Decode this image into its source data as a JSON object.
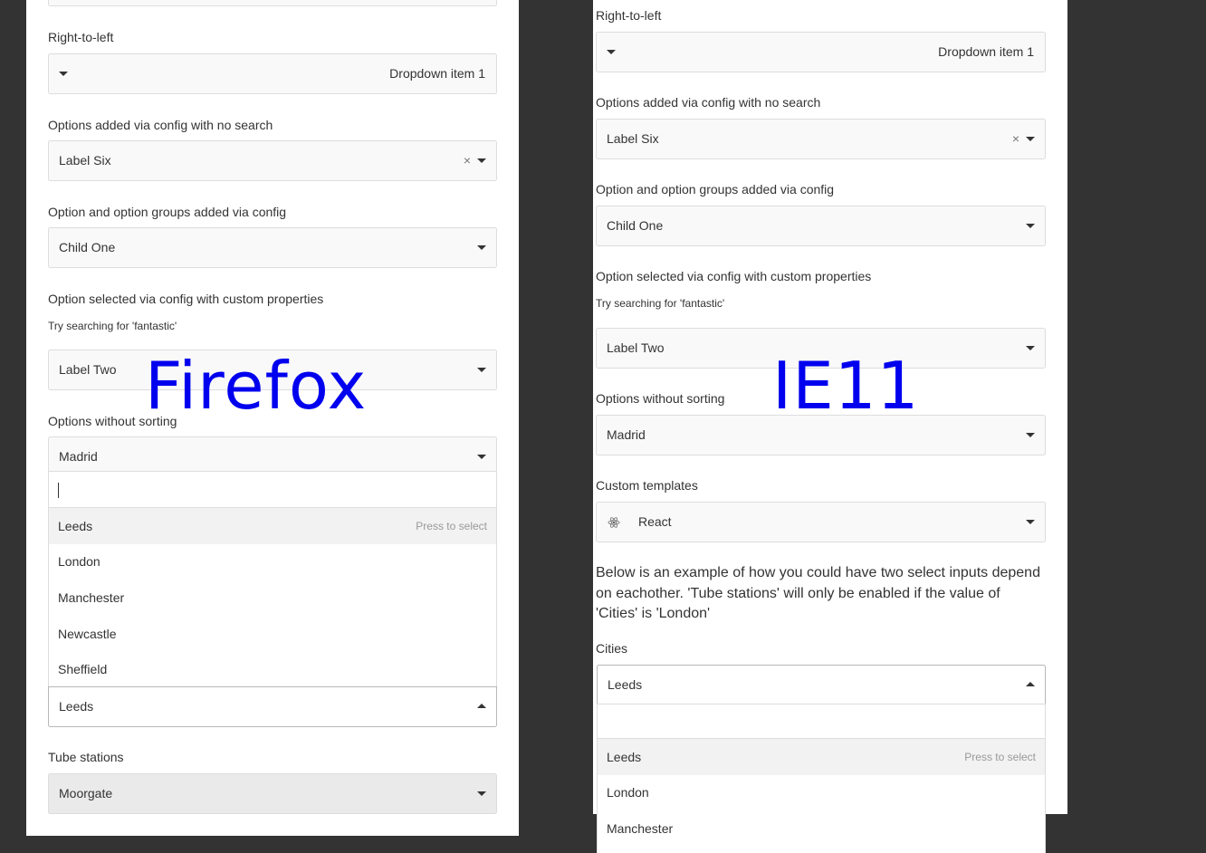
{
  "firefox": {
    "watermark": "Firefox",
    "rtl": {
      "label": "Right-to-left",
      "value": "Dropdown item 1"
    },
    "no_search": {
      "label": "Options added via config with no search",
      "value": "Label Six",
      "remove": "×"
    },
    "groups": {
      "label": "Option and option groups added via config",
      "value": "Child One"
    },
    "custom_props": {
      "label": "Option selected via config with custom properties",
      "hint": "Try searching for 'fantastic'",
      "value": "Label Two"
    },
    "no_sorting": {
      "label": "Options without sorting",
      "value": "Madrid"
    },
    "cities_dropdown": {
      "press_to_select": "Press to select",
      "options": [
        "Leeds",
        "London",
        "Manchester",
        "Newcastle",
        "Sheffield"
      ]
    },
    "cities": {
      "value": "Leeds"
    },
    "tube": {
      "label": "Tube stations",
      "value": "Moorgate"
    }
  },
  "ie11": {
    "watermark": "IE11",
    "rtl": {
      "label": "Right-to-left",
      "value": "Dropdown item 1"
    },
    "no_search": {
      "label": "Options added via config with no search",
      "value": "Label Six",
      "remove": "×"
    },
    "groups": {
      "label": "Option and option groups added via config",
      "value": "Child One"
    },
    "custom_props": {
      "label": "Option selected via config with custom properties",
      "hint": "Try searching for 'fantastic'",
      "value": "Label Two"
    },
    "no_sorting": {
      "label": "Options without sorting",
      "value": "Madrid"
    },
    "custom_templates": {
      "label": "Custom templates",
      "value": "React",
      "icon": "react-icon"
    },
    "dependent_text": [
      "Below is an example of how you could have two select inputs depend",
      "on eachother. 'Tube stations' will only be enabled if the value of",
      "'Cities' is 'London'"
    ],
    "cities": {
      "label": "Cities",
      "value": "Leeds"
    },
    "cities_dropdown": {
      "press_to_select": "Press to select",
      "options": [
        "Leeds",
        "London",
        "Manchester"
      ]
    }
  }
}
